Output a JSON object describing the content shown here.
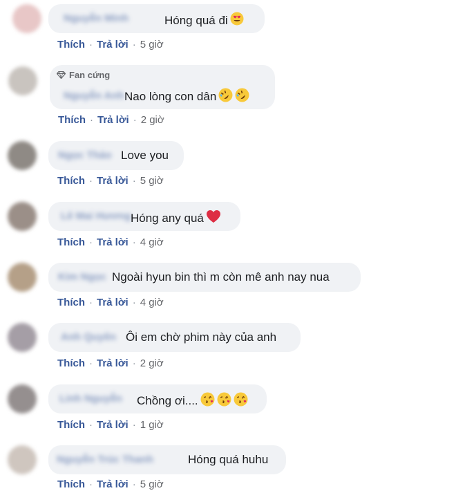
{
  "comments": [
    {
      "author": "Nguyễn Minh",
      "badge": "",
      "text": "Hóng quá đi",
      "emoji": [
        "heart-eyes-emoji"
      ],
      "like": "Thích",
      "reply": "Trả lời",
      "time": "5 giờ"
    },
    {
      "author": "Nguyễn Anh",
      "badge": "Fan cứng",
      "text": "Nao lòng con dân",
      "emoji": [
        "rofl-emoji",
        "rofl-emoji"
      ],
      "like": "Thích",
      "reply": "Trả lời",
      "time": "2 giờ"
    },
    {
      "author": "Ngọc Thảo",
      "badge": "",
      "text": "Love you",
      "emoji": [],
      "like": "Thích",
      "reply": "Trả lời",
      "time": "5 giờ"
    },
    {
      "author": "Lê Mai Hương",
      "badge": "",
      "text": "Hóng any quá",
      "emoji": [
        "red-heart-emoji"
      ],
      "like": "Thích",
      "reply": "Trả lời",
      "time": "4 giờ"
    },
    {
      "author": "Kim Ngọc",
      "badge": "",
      "text": "Ngoài hyun bin thì m còn mê anh nay nua",
      "emoji": [],
      "like": "Thích",
      "reply": "Trả lời",
      "time": "4 giờ"
    },
    {
      "author": "Anh Quyên",
      "badge": "",
      "text": "Ôi em chờ phim này của anh",
      "emoji": [],
      "like": "Thích",
      "reply": "Trả lời",
      "time": "2 giờ"
    },
    {
      "author": "Linh Nguyễn",
      "badge": "",
      "text": "Chồng ơi....",
      "emoji": [
        "kiss-emoji",
        "kiss-emoji",
        "kiss-emoji"
      ],
      "like": "Thích",
      "reply": "Trả lời",
      "time": "1 giờ"
    },
    {
      "author": "Nguyễn Trúc Thanh",
      "badge": "",
      "text": "Hóng quá huhu",
      "emoji": [],
      "like": "Thích",
      "reply": "Trả lời",
      "time": "5 giờ"
    }
  ],
  "colors": {
    "bubble": "#f0f2f5",
    "link": "#385898",
    "meta": "#65676b",
    "text": "#1c1e21"
  }
}
